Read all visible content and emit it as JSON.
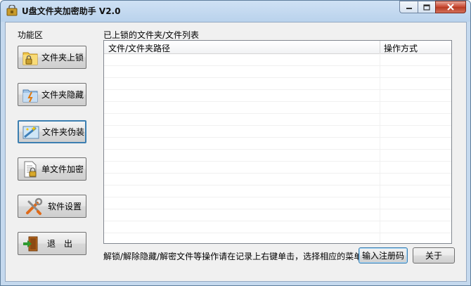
{
  "window": {
    "title": "U盘文件夹加密助手 V2.0",
    "controls": {
      "minimize": "−",
      "maximize": "□",
      "close": "✕"
    }
  },
  "sidebar": {
    "group_label": "功能区",
    "buttons": [
      {
        "label": "文件夹上锁",
        "icon": "folder-lock-icon"
      },
      {
        "label": "文件夹隐藏",
        "icon": "folder-hide-icon"
      },
      {
        "label": "文件夹伪装",
        "icon": "folder-disguise-icon"
      },
      {
        "label": "单文件加密",
        "icon": "file-encrypt-icon"
      },
      {
        "label": "软件设置",
        "icon": "tools-icon"
      },
      {
        "label": "退　出",
        "icon": "exit-door-icon"
      }
    ]
  },
  "list": {
    "title": "已上锁的文件夹/文件列表",
    "columns": [
      "文件/文件夹路径",
      "操作方式"
    ],
    "rows": []
  },
  "footer": {
    "hint": "解锁/解除隐藏/解密文件等操作请在记录上右键单击，选择相应的菜单。",
    "register_label": "输入注册码",
    "about_label": "关于"
  }
}
